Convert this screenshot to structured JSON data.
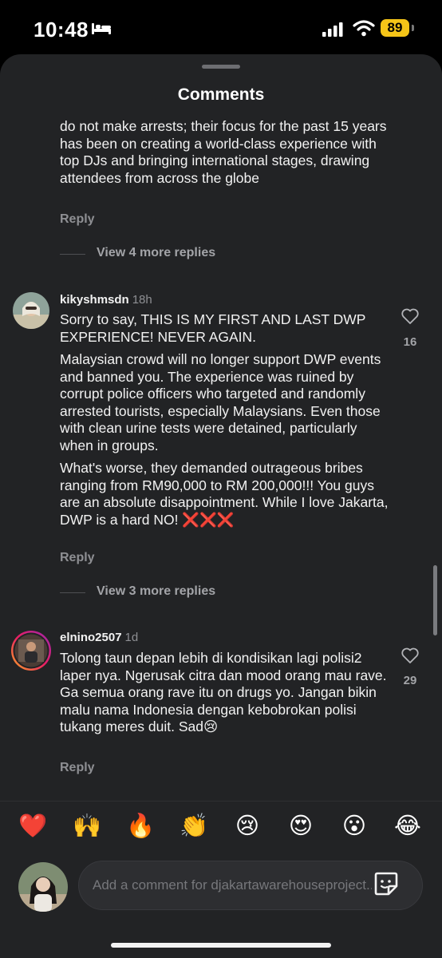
{
  "status_bar": {
    "time": "10:48",
    "battery": "89"
  },
  "sheet": {
    "title": "Comments"
  },
  "comments": [
    {
      "paragraphs": [
        "do not make arrests; their focus for the past 15 years has been on creating a world-class experience with top DJs and bringing international stages, drawing attendees from across the globe"
      ],
      "reply_label": "Reply",
      "view_more": "View 4 more replies"
    },
    {
      "username": "kikyshmsdn",
      "time_ago": "18h",
      "likes": "16",
      "paragraphs": [
        "Sorry to say, THIS IS MY FIRST AND LAST DWP EXPERIENCE! NEVER AGAIN.",
        "Malaysian crowd will no longer support DWP events and banned you. The experience was ruined by corrupt police officers who targeted and randomly arrested tourists, especially Malaysians. Even those with clean urine tests were detained, particularly when in groups.",
        "What's worse, they demanded outrageous bribes ranging from RM90,000 to RM 200,000!!! You guys are an absolute disappointment. While I love Jakarta, DWP is a hard NO! ❌❌❌"
      ],
      "reply_label": "Reply",
      "view_more": "View 3 more replies"
    },
    {
      "username": "elnino2507",
      "time_ago": "1d",
      "likes": "29",
      "paragraphs": [
        "Tolong taun depan lebih di kondisikan lagi polisi2 laper nya. Ngerusak citra dan mood orang mau rave. Ga semua orang rave itu on drugs yo. Jangan bikin malu nama Indonesia dengan kebobrokan polisi tukang meres duit. Sad😢"
      ],
      "reply_label": "Reply"
    }
  ],
  "emoji_bar": [
    "❤️",
    "🙌",
    "🔥",
    "👏",
    "😢",
    "😍",
    "😮",
    "😂"
  ],
  "composer": {
    "placeholder": "Add a comment for djakartawarehouseproject..."
  },
  "colors": {
    "sheet_bg": "#222325",
    "battery": "#f5c518",
    "muted_text": "#8e8f93"
  },
  "icons": [
    "bed-icon",
    "signal-icon",
    "wifi-icon",
    "heart-outline-icon",
    "sticker-icon"
  ]
}
